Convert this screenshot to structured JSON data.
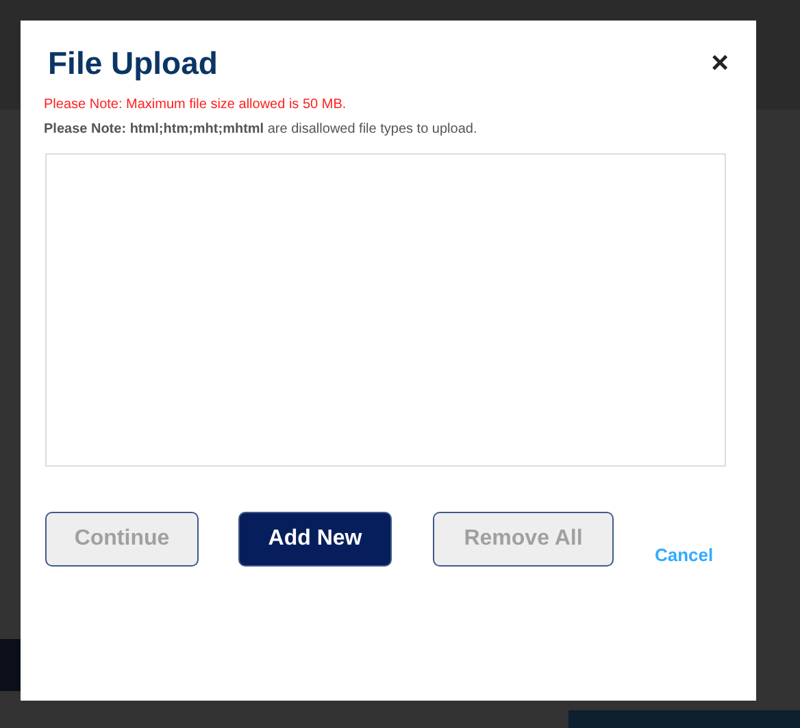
{
  "dialog": {
    "title": "File Upload",
    "close": "×",
    "notes": [
      {
        "kind": "warning",
        "text": "Please Note: Maximum file size allowed is 50 MB."
      },
      {
        "kind": "info",
        "text": "**Please Note:** **html;htm;mht;mhtml** are disallowed file types to upload."
      }
    ],
    "buttons": [
      {
        "label": "Continue",
        "kind": "secondary",
        "disabled": true
      },
      {
        "label": "Add New",
        "kind": "primary",
        "disabled": false
      },
      {
        "label": "Remove All",
        "kind": "secondary",
        "disabled": true
      },
      {
        "label": "Cancel",
        "kind": "link",
        "disabled": false
      }
    ]
  }
}
